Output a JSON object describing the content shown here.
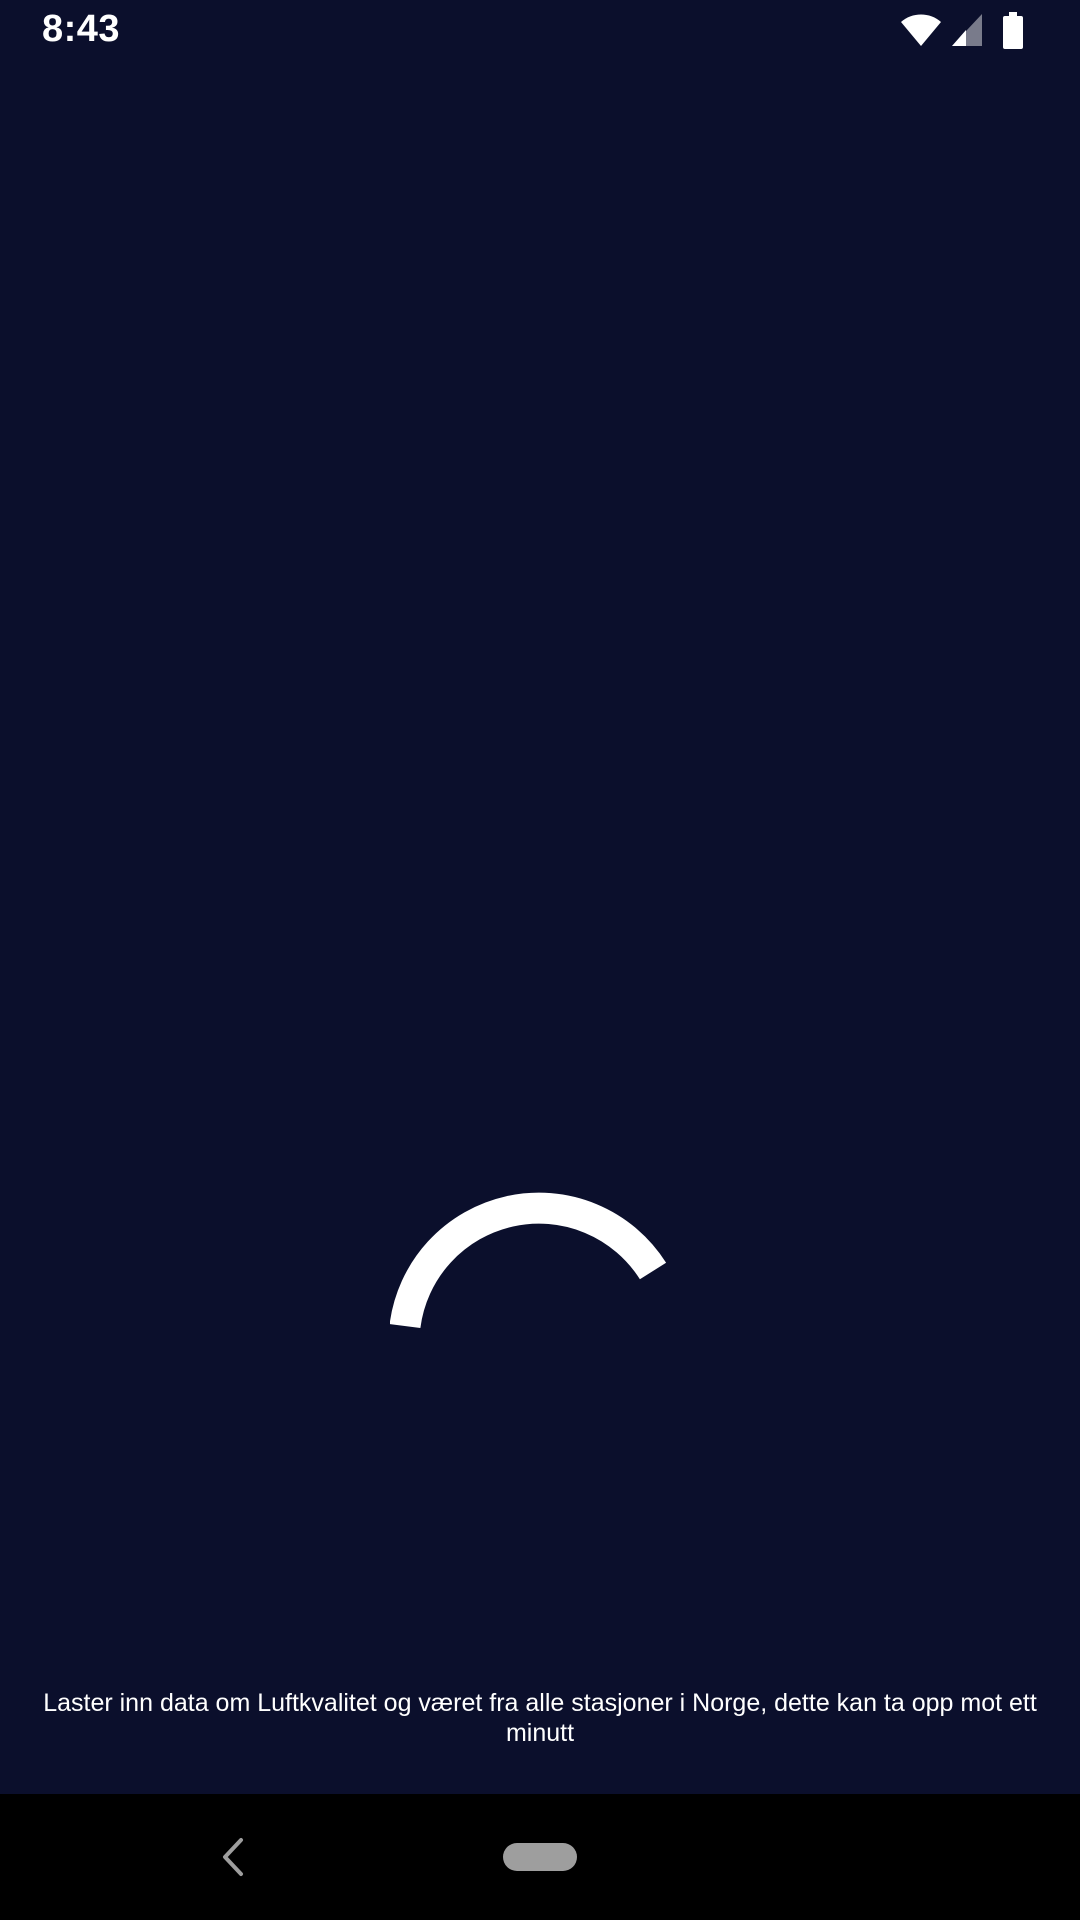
{
  "status_bar": {
    "time": "8:43",
    "icons": [
      "wifi-icon",
      "cellular-signal-icon",
      "battery-icon"
    ]
  },
  "loading": {
    "spinner_icon": "progress-spinner-icon",
    "message": "Laster inn data om Luftkvalitet og været fra alle stasjoner i Norge, dette kan ta opp mot ett minutt"
  },
  "navigation_bar": {
    "back_icon": "back-chevron-icon",
    "home_icon": "home-pill-icon"
  },
  "colors": {
    "background": "#0b0f2c",
    "foreground": "#ffffff",
    "nav_bar": "#000000",
    "home_pill": "#9e9e9e"
  }
}
